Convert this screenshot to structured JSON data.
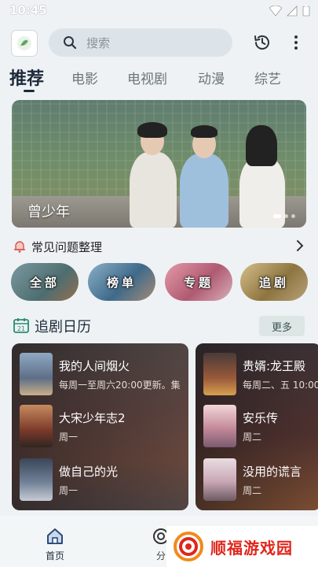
{
  "status_bar": {
    "time": "10:45"
  },
  "search": {
    "placeholder": "搜索"
  },
  "tabs": [
    {
      "label": "推荐",
      "active": true
    },
    {
      "label": "电影"
    },
    {
      "label": "电视剧"
    },
    {
      "label": "动漫"
    },
    {
      "label": "综艺"
    }
  ],
  "banner": {
    "title": "曾少年"
  },
  "faq": {
    "label": "常见问题整理"
  },
  "categories": [
    {
      "label": "全部",
      "color": "#5b7f86"
    },
    {
      "label": "榜单",
      "color": "#4f7899"
    },
    {
      "label": "专题",
      "color": "#b96678"
    },
    {
      "label": "追剧",
      "color": "#9a8a55"
    }
  ],
  "calendar": {
    "title": "追剧日历",
    "more_label": "更多",
    "left_column": [
      {
        "name": "我的人间烟火",
        "schedule": "每周一至周六20:00更新。集"
      },
      {
        "name": "大宋少年志2",
        "schedule": "周一"
      },
      {
        "name": "做自己的光",
        "schedule": "周一"
      }
    ],
    "right_column": [
      {
        "name": "贵婿:龙王殿",
        "schedule": "每周二、五 10:00"
      },
      {
        "name": "安乐传",
        "schedule": "周二"
      },
      {
        "name": "没用的谎言",
        "schedule": "周二"
      }
    ]
  },
  "bottom_nav": {
    "home": "首页",
    "category": "分"
  },
  "watermark": {
    "text": "顺福游戏园"
  }
}
